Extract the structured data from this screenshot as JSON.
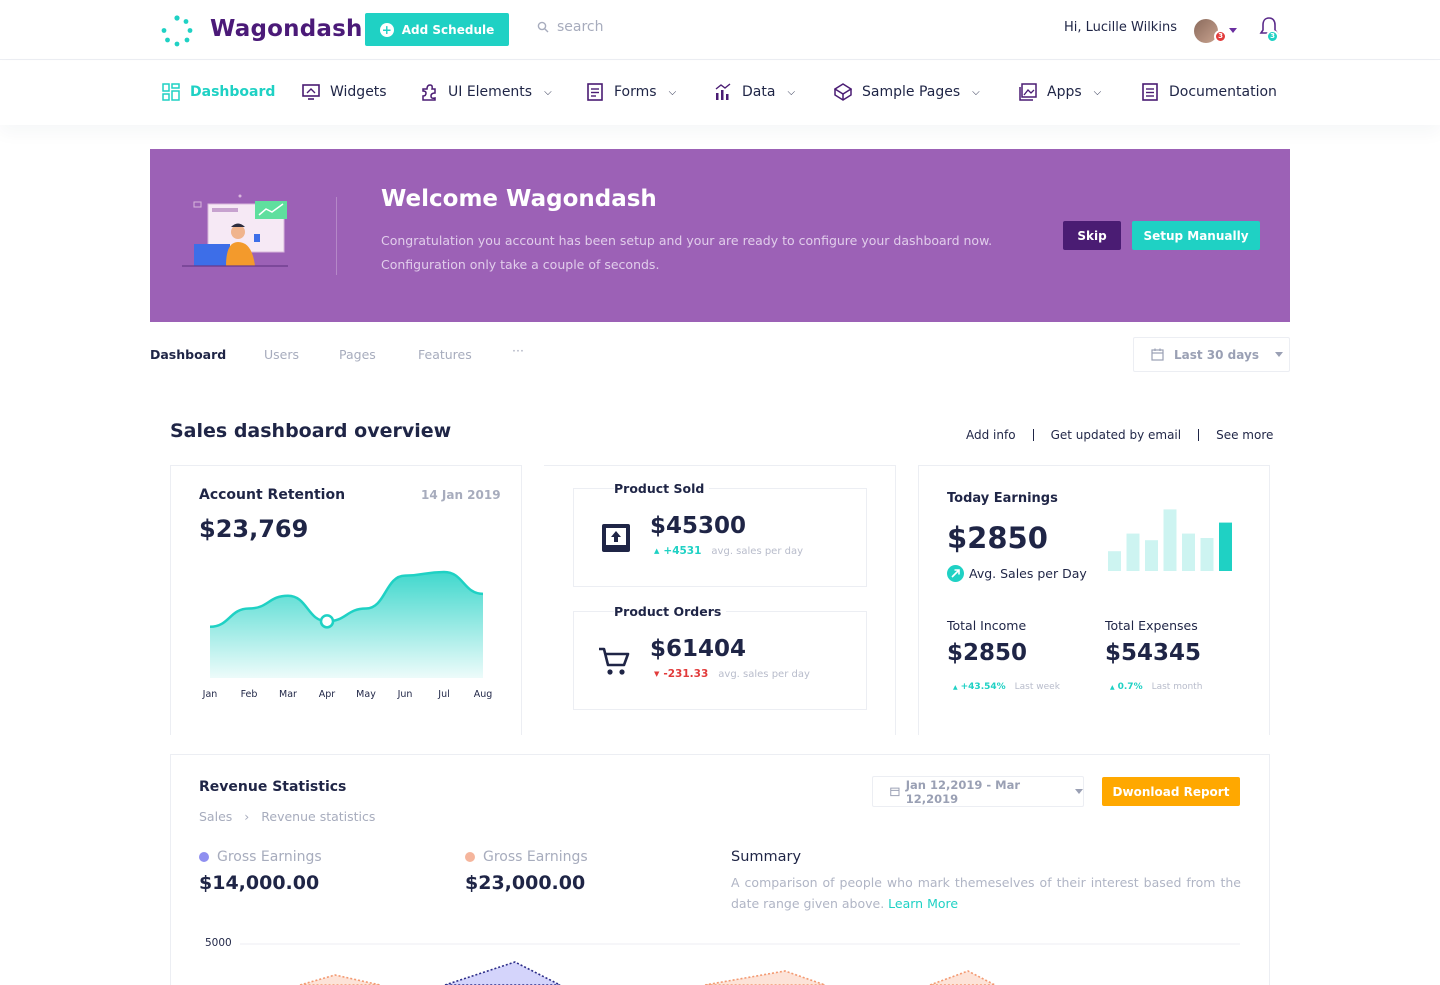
{
  "header": {
    "brand": "Wagondash",
    "add_schedule": "Add Schedule",
    "search_placeholder": "search",
    "greeting": "Hi, Lucille Wilkins",
    "avatar_badge": "3",
    "bell_badge": "3",
    "colors": {
      "brand": "#4b1a78",
      "accent": "#1fd1c4"
    }
  },
  "nav": {
    "items": [
      {
        "label": "Dashboard",
        "icon": "grid-icon",
        "active": true
      },
      {
        "label": "Widgets",
        "icon": "monitor-icon"
      },
      {
        "label": "UI Elements",
        "icon": "puzzle-icon",
        "dropdown": true
      },
      {
        "label": "Forms",
        "icon": "form-icon",
        "dropdown": true
      },
      {
        "label": "Data",
        "icon": "bar-chart-icon",
        "dropdown": true
      },
      {
        "label": "Sample Pages",
        "icon": "cube-icon",
        "dropdown": true
      },
      {
        "label": "Apps",
        "icon": "gallery-icon",
        "dropdown": true
      },
      {
        "label": "Documentation",
        "icon": "document-icon"
      }
    ]
  },
  "welcome": {
    "title": "Welcome Wagondash",
    "text": "Congratulation you account has been setup and your are ready to configure your dashboard now. Configuration only take a couple of seconds.",
    "skip": "Skip",
    "setup": "Setup Manually",
    "bg_color": "#9c61b6"
  },
  "tabs": {
    "items": [
      "Dashboard",
      "Users",
      "Pages",
      "Features",
      "···"
    ],
    "range": "Last 30 days"
  },
  "overview": {
    "title": "Sales dashboard overview",
    "links": [
      "Add info",
      "Get updated by email",
      "See more"
    ]
  },
  "retention": {
    "title": "Account Retention",
    "date": "14 Jan 2019",
    "value": "$23,769",
    "chart_data": {
      "type": "area",
      "x": [
        "Jan",
        "Feb",
        "Mar",
        "Apr",
        "May",
        "Jun",
        "Jul",
        "Aug"
      ],
      "values": [
        28,
        38,
        45,
        31,
        38,
        56,
        58,
        46
      ],
      "highlight_index": 3,
      "color": "#1fd1c4"
    }
  },
  "product_sold": {
    "title": "Product Sold",
    "value": "$45300",
    "delta": "+4531",
    "delta_dir": "up",
    "sub": "avg. sales per day"
  },
  "product_orders": {
    "title": "Product Orders",
    "value": "$61404",
    "delta": "-231.33",
    "delta_dir": "down",
    "sub": "avg. sales per day"
  },
  "earnings": {
    "title": "Today Earnings",
    "value": "$2850",
    "avg_label": "Avg. Sales per Day",
    "chart_data": {
      "type": "bar",
      "values": [
        18,
        34,
        28,
        56,
        34,
        30,
        44
      ],
      "highlight_index": 6,
      "colors": {
        "bar": "#cdf4f1",
        "highlight": "#1fd1c4"
      }
    },
    "income": {
      "label": "Total Income",
      "value": "$2850",
      "delta": "+43.54%",
      "sub": "Last week"
    },
    "expenses": {
      "label": "Total Expenses",
      "value": "$54345",
      "delta": "0.7%",
      "sub": "Last month"
    }
  },
  "revenue": {
    "title": "Revenue Statistics",
    "breadcrumb": [
      "Sales",
      "Revenue statistics"
    ],
    "date_range": "Jan 12,2019 - Mar 12,2019",
    "download": "Dwonload Report",
    "gross1": {
      "label": "Gross Earnings",
      "value": "$14,000.00",
      "color": "#8f8ff0"
    },
    "gross2": {
      "label": "Gross Earnings",
      "value": "$23,000.00",
      "color": "#f5b59c"
    },
    "summary_title": "Summary",
    "summary_text": "A comparison of people who mark themeselves of their interest based from the date range given above.",
    "learn_more": "Learn More",
    "y_tick": "5000"
  }
}
